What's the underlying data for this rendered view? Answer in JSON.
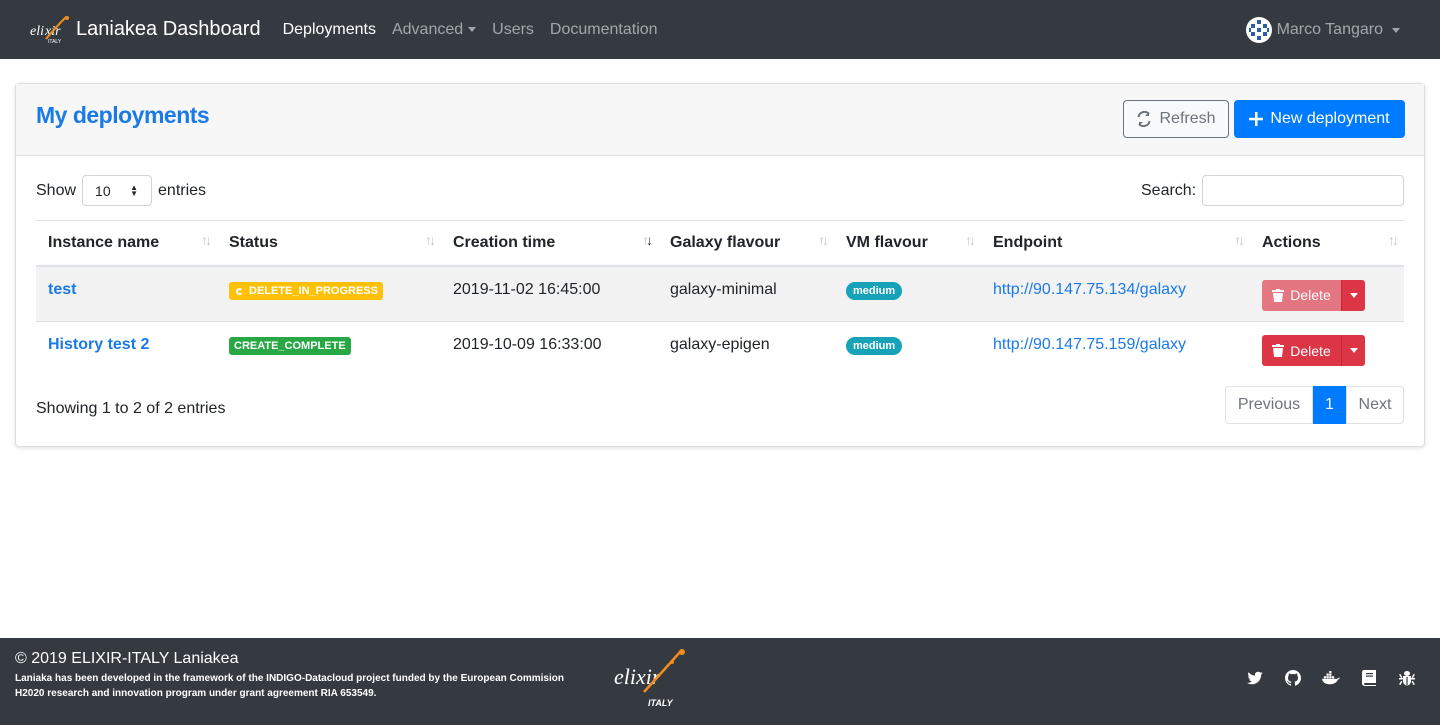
{
  "navbar": {
    "brand": "Laniakea Dashboard",
    "links": [
      {
        "label": "Deployments",
        "active": true
      },
      {
        "label": "Advanced",
        "dropdown": true
      },
      {
        "label": "Users"
      },
      {
        "label": "Documentation"
      }
    ],
    "user": "Marco Tangaro"
  },
  "card": {
    "title": "My deployments",
    "refresh_label": "Refresh",
    "new_label": "New deployment"
  },
  "table_controls": {
    "show": "Show",
    "length_value": "10",
    "entries": "entries",
    "search_label": "Search:",
    "search_value": ""
  },
  "columns": [
    "Instance name",
    "Status",
    "Creation time",
    "Galaxy flavour",
    "VM flavour",
    "Endpoint",
    "Actions"
  ],
  "rows": [
    {
      "name": "test",
      "status": "DELETE_IN_PROGRESS",
      "created": "2019-11-02 16:45:00",
      "galaxy": "galaxy-minimal",
      "vm": "medium",
      "endpoint": "http://90.147.75.134/galaxy",
      "action": "Delete"
    },
    {
      "name": "History test 2",
      "status": "CREATE_COMPLETE",
      "created": "2019-10-09 16:33:00",
      "galaxy": "galaxy-epigen",
      "vm": "medium",
      "endpoint": "http://90.147.75.159/galaxy",
      "action": "Delete"
    }
  ],
  "footer_info": "Showing 1 to 2 of 2 entries",
  "pagination": {
    "previous": "Previous",
    "page": "1",
    "next": "Next"
  },
  "footer": {
    "title": "© 2019 ELIXIR-ITALY Laniakea",
    "line1": "Laniaka has been developed in the framework of the INDIGO-Datacloud project funded by the European Commision",
    "line2": "H2020 research and innovation program under grant agreement RIA 653549.",
    "logo_text": "elixir",
    "logo_sub": "ITALY",
    "icons": [
      "twitter-icon",
      "github-icon",
      "docker-icon",
      "book-icon",
      "bug-icon"
    ]
  },
  "colors": {
    "primary": "#007bff",
    "danger": "#dc3545",
    "warning": "#ffc107",
    "success": "#28a745",
    "info": "#17a2b8",
    "navbar": "#343a40"
  }
}
